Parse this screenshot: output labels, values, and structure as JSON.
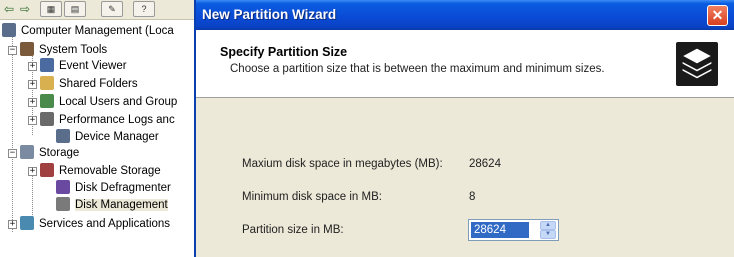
{
  "toolbar": {
    "buttons": [
      "⇦",
      "⇨",
      "▦",
      "▤",
      "✎",
      "?"
    ]
  },
  "tree": {
    "items": [
      {
        "label": "Computer Management (Loca",
        "icon": "computer-icon",
        "color": "#5a6e8c"
      },
      {
        "label": "System Tools",
        "icon": "tools-icon",
        "color": "#7a5a3a"
      },
      {
        "label": "Event Viewer",
        "icon": "event-viewer-icon",
        "color": "#4a6aa0"
      },
      {
        "label": "Shared Folders",
        "icon": "shared-folders-icon",
        "color": "#d8b050"
      },
      {
        "label": "Local Users and Group",
        "icon": "users-icon",
        "color": "#4a8a4a"
      },
      {
        "label": "Performance Logs anc",
        "icon": "performance-icon",
        "color": "#6a6a6a"
      },
      {
        "label": "Device Manager",
        "icon": "device-manager-icon",
        "color": "#5a6e8c"
      },
      {
        "label": "Storage",
        "icon": "storage-icon",
        "color": "#7a8aa0"
      },
      {
        "label": "Removable Storage",
        "icon": "removable-storage-icon",
        "color": "#a04040"
      },
      {
        "label": "Disk Defragmenter",
        "icon": "defragmenter-icon",
        "color": "#6a4aa0"
      },
      {
        "label": "Disk Management",
        "icon": "disk-management-icon",
        "color": "#7a7a7a"
      },
      {
        "label": "Services and Applications",
        "icon": "services-icon",
        "color": "#4a8ab0"
      }
    ]
  },
  "wizard": {
    "title": "New Partition Wizard",
    "close_label": "✕",
    "header_title": "Specify Partition Size",
    "header_subtitle": "Choose a partition size that is between the maximum and minimum sizes.",
    "fields": [
      {
        "label": "Maxium disk space in megabytes (MB):",
        "value": "28624"
      },
      {
        "label": "Minimum disk space in MB:",
        "value": "8"
      }
    ],
    "partition_size_label": "Partition size in MB:",
    "partition_size_value": "28624",
    "spin_up": "▲",
    "spin_down": "▼"
  },
  "colors": {
    "titlebar": "#0a4bd6",
    "selection": "#316ac5",
    "dialog_bg": "#ece9d8"
  }
}
